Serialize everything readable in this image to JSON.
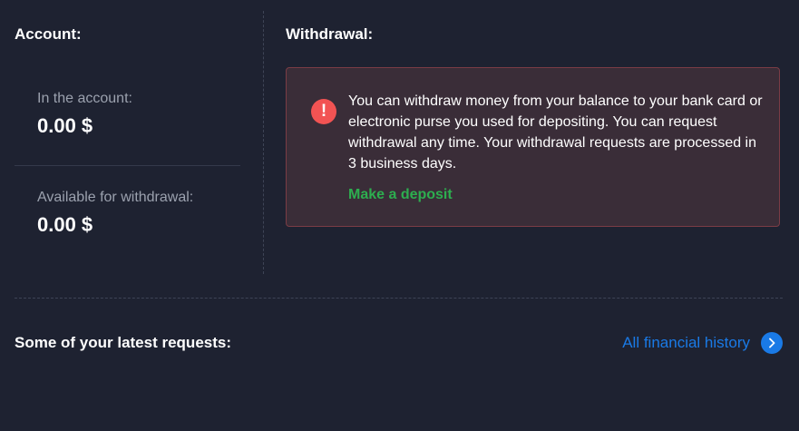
{
  "account": {
    "heading": "Account:",
    "in_account_label": "In the account:",
    "in_account_value": "0.00 $",
    "available_label": "Available for withdrawal:",
    "available_value": "0.00 $"
  },
  "withdrawal": {
    "heading": "Withdrawal:",
    "notice_icon": "exclamation-circle-icon",
    "notice_icon_glyph": "!",
    "notice_text": "You can withdraw money from your balance to your bank card or electronic purse you used for depositing. You can request withdrawal any time. Your withdrawal requests are processed in 3 business days.",
    "deposit_link": "Make a deposit"
  },
  "latest": {
    "heading": "Some of your latest requests:",
    "history_link": "All financial history",
    "history_icon": "chevron-right-icon"
  },
  "colors": {
    "background": "#1e2231",
    "notice_background": "#3a2d38",
    "notice_border": "#7b3c45",
    "alert_red": "#f25353",
    "link_green": "#2dae4f",
    "link_blue": "#1a7ae6",
    "muted_text": "#9ba1ae"
  }
}
